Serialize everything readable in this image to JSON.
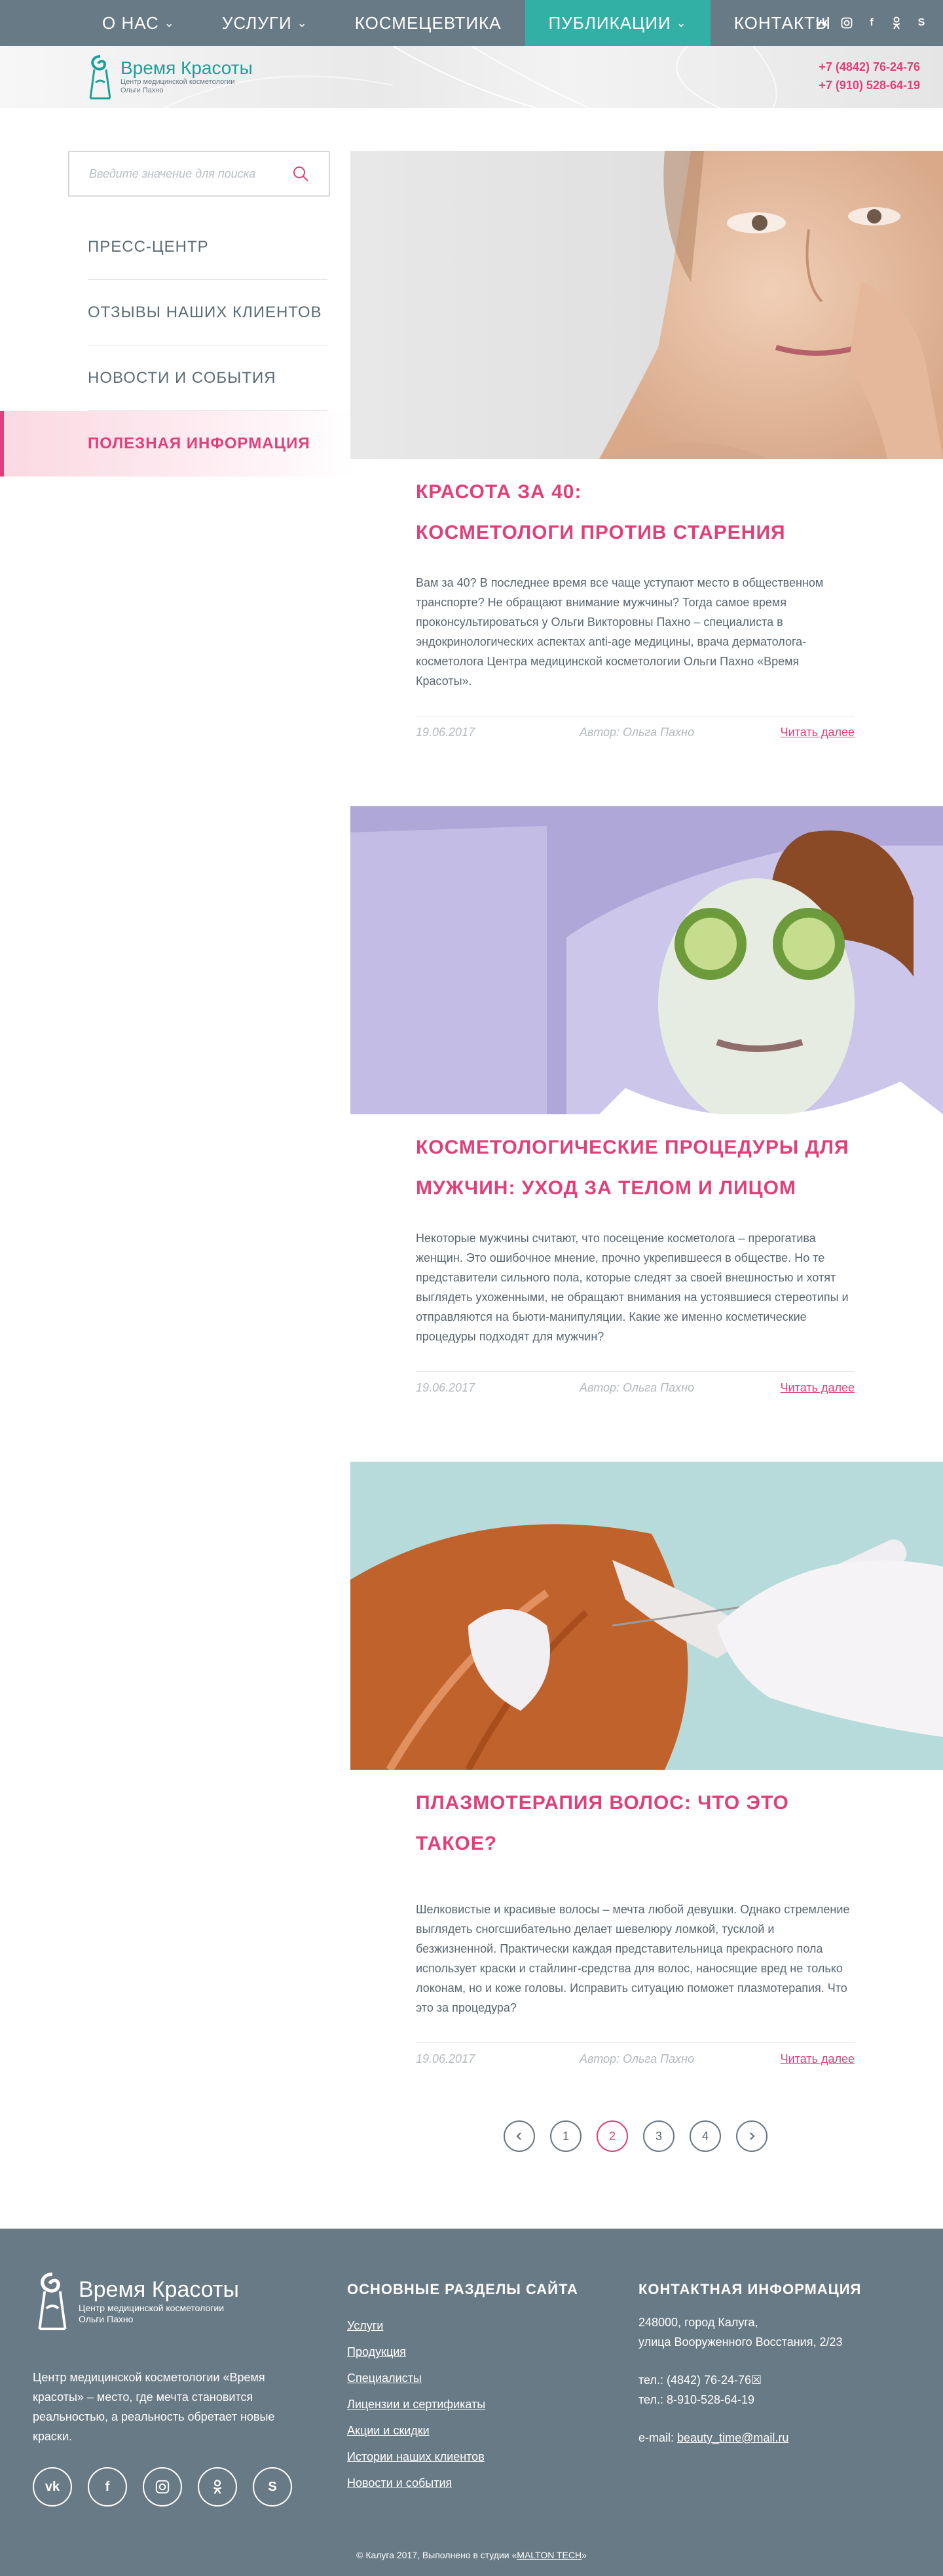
{
  "nav": {
    "items": [
      {
        "label": "О НАС",
        "has_dropdown": true
      },
      {
        "label": "УСЛУГИ",
        "has_dropdown": true
      },
      {
        "label": "КОСМЕЦЕВТИКА",
        "has_dropdown": false
      },
      {
        "label": "ПУБЛИКАЦИИ",
        "has_dropdown": true,
        "active": true
      },
      {
        "label": "КОНТАКТЫ",
        "has_dropdown": false
      }
    ],
    "social_icons": [
      "vk-icon",
      "instagram-icon",
      "facebook-icon",
      "odnoklassniki-icon",
      "skype-icon"
    ]
  },
  "header": {
    "logo_title": "Время Красоты",
    "logo_sub1": "Центр медицинской косметологии",
    "logo_sub2": "Ольги Пахно",
    "phone1": "+7 (4842) 76-24-76",
    "phone2": "+7 (910) 528-64-19"
  },
  "sidebar": {
    "search_placeholder": "Введите значение для поиска",
    "items": [
      {
        "label": "ПРЕСС-ЦЕНТР"
      },
      {
        "label": "ОТЗЫВЫ НАШИХ КЛИЕНТОВ"
      },
      {
        "label": "НОВОСТИ И СОБЫТИЯ"
      },
      {
        "label": "ПОЛЕЗНАЯ ИНФОРМАЦИЯ",
        "active": true
      }
    ]
  },
  "articles": [
    {
      "title_line1": "КРАСОТА ЗА 40:",
      "title_line2": "КОСМЕТОЛОГИ ПРОТИВ СТАРЕНИЯ",
      "text": "Вам за 40? В последнее время все чаще уступают место в общественном транспорте? Не обращают внимание мужчины? Тогда самое время проконсультироваться у Ольги Викторовны Пахно – специалиста в эндокринологических аспектах anti-age медицины, врача дерматолога-косметолога Центра медицинской косметологии Ольги Пахно «Время Красоты».",
      "date": "19.06.2017",
      "author": "Автор: Ольга Пахно",
      "more": "Читать далее"
    },
    {
      "title_line1": "КОСМЕТОЛОГИЧЕСКИЕ ПРОЦЕДУРЫ ДЛЯ",
      "title_line2": "МУЖЧИН: УХОД ЗА ТЕЛОМ И ЛИЦОМ",
      "text": "Некоторые мужчины считают, что посещение косметолога – прерогатива женщин. Это ошибочное мнение, прочно укрепившееся в обществе. Но те представители сильного пола, которые следят за своей внешностью и хотят выглядеть ухоженными, не обращают внимания на устоявшиеся стереотипы и отправляются на бьюти-манипуляции. Какие же именно косметические процедуры подходят для мужчин?",
      "date": "19.06.2017",
      "author": "Автор: Ольга Пахно",
      "more": "Читать далее"
    },
    {
      "title_line1": "ПЛАЗМОТЕРАПИЯ ВОЛОС: ЧТО ЭТО ТАКОЕ?",
      "title_line2": "",
      "text": "Шелковистые и красивые волосы – мечта любой девушки. Однако стремление выглядеть сногсшибательно делает шевелюру ломкой, тусклой и безжизненной. Практически каждая представительница прекрасного пола использует краски и стайлинг-средства для волос, наносящие вред не только локонам, но и коже головы. Исправить ситуацию поможет плазмотерапия. Что это за процедура?",
      "date": "19.06.2017",
      "author": "Автор: Ольга Пахно",
      "more": "Читать далее"
    }
  ],
  "pagination": {
    "pages": [
      "1",
      "2",
      "3",
      "4"
    ],
    "current": "2"
  },
  "footer": {
    "logo_title": "Время Красоты",
    "logo_sub1": "Центр медицинской косметологии",
    "logo_sub2": "Ольги Пахно",
    "description": "Центр медицинской косметологии «Время красоты» – место, где мечта становится реальностью, а реальность обретает новые краски.",
    "sections_title": "ОСНОВНЫЕ РАЗДЕЛЫ САЙТА",
    "links": [
      "Услуги",
      "Продукция",
      "Специалисты",
      "Лицензии и сертификаты",
      "Акции и скидки",
      "Истории наших клиентов",
      "Новости и события"
    ],
    "contact_title": "КОНТАКТНАЯ ИНФОРМАЦИЯ",
    "address1": "248000, город Калуга,",
    "address2": "улица Вооруженного Восстания, 2/23",
    "tel1": "тел.: (4842) 76-24-76☒",
    "tel2": "тел.: 8-910-528-64-19",
    "email_label": "e-mail: ",
    "email": "beauty_time@mail.ru",
    "copyright_prefix": "© Калуга 2017, Выполнено в студии «",
    "studio": "MALTON TECH",
    "copyright_suffix": "»",
    "social_icons": [
      "vk-icon",
      "facebook-icon",
      "instagram-icon",
      "odnoklassniki-icon",
      "skype-icon"
    ]
  },
  "colors": {
    "nav_bg": "#687a86",
    "nav_active": "#33b0a6",
    "accent_pink": "#e0407a",
    "text": "#5b6670"
  }
}
